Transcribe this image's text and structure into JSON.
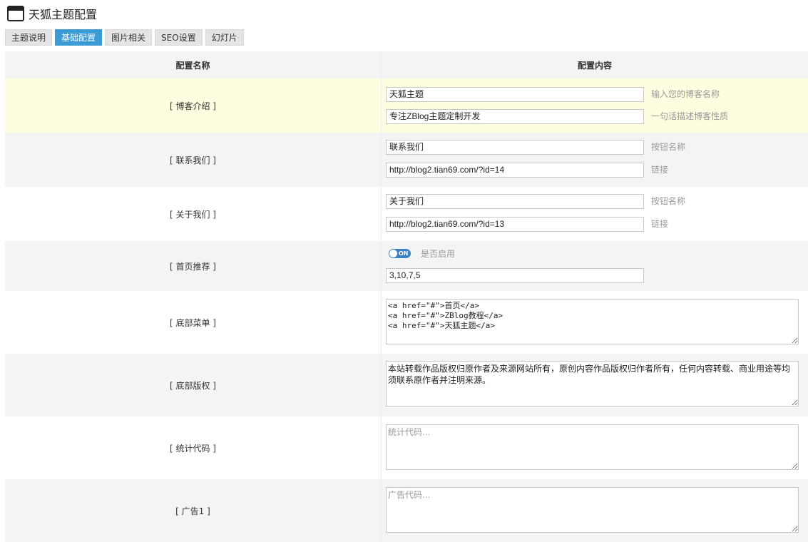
{
  "page": {
    "title": "天狐主题配置",
    "icon": "window-icon"
  },
  "tabs": [
    {
      "label": "主题说明",
      "active": false
    },
    {
      "label": "基础配置",
      "active": true
    },
    {
      "label": "图片相关",
      "active": false
    },
    {
      "label": "SEO设置",
      "active": false
    },
    {
      "label": "幻灯片",
      "active": false
    }
  ],
  "table": {
    "headers": {
      "name": "配置名称",
      "content": "配置内容"
    },
    "rows": {
      "blog_intro": {
        "label": "[ 博客介绍 ]",
        "name_value": "天狐主题",
        "name_hint": "输入您的博客名称",
        "desc_value": "专注ZBlog主题定制开发",
        "desc_hint": "一句话描述博客性质"
      },
      "contact": {
        "label": "[ 联系我们 ]",
        "button_value": "联系我们",
        "button_hint": "按钮名称",
        "link_value": "http://blog2.tian69.com/?id=14",
        "link_hint": "链接"
      },
      "about": {
        "label": "[ 关于我们 ]",
        "button_value": "关于我们",
        "button_hint": "按钮名称",
        "link_value": "http://blog2.tian69.com/?id=13",
        "link_hint": "链接"
      },
      "home_recommend": {
        "label": "[ 首页推荐 ]",
        "toggle_text": "ON",
        "toggle_on": true,
        "toggle_label": "是否启用",
        "ids_value": "3,10,7,5"
      },
      "footer_menu": {
        "label": "[ 底部菜单 ]",
        "value": "<a href=\"#\">首页</a>\n<a href=\"#\">ZBlog教程</a>\n<a href=\"#\">天狐主题</a>"
      },
      "footer_copyright": {
        "label": "[ 底部版权 ]",
        "value": "本站转载作品版权归原作者及来源网站所有，原创内容作品版权归作者所有，任何内容转载、商业用途等均须联系原作者并注明来源。"
      },
      "stats_code": {
        "label": "[ 统计代码 ]",
        "placeholder": "统计代码..."
      },
      "ad1": {
        "label": "[ 广告1 ]",
        "placeholder": "广告代码..."
      }
    }
  }
}
